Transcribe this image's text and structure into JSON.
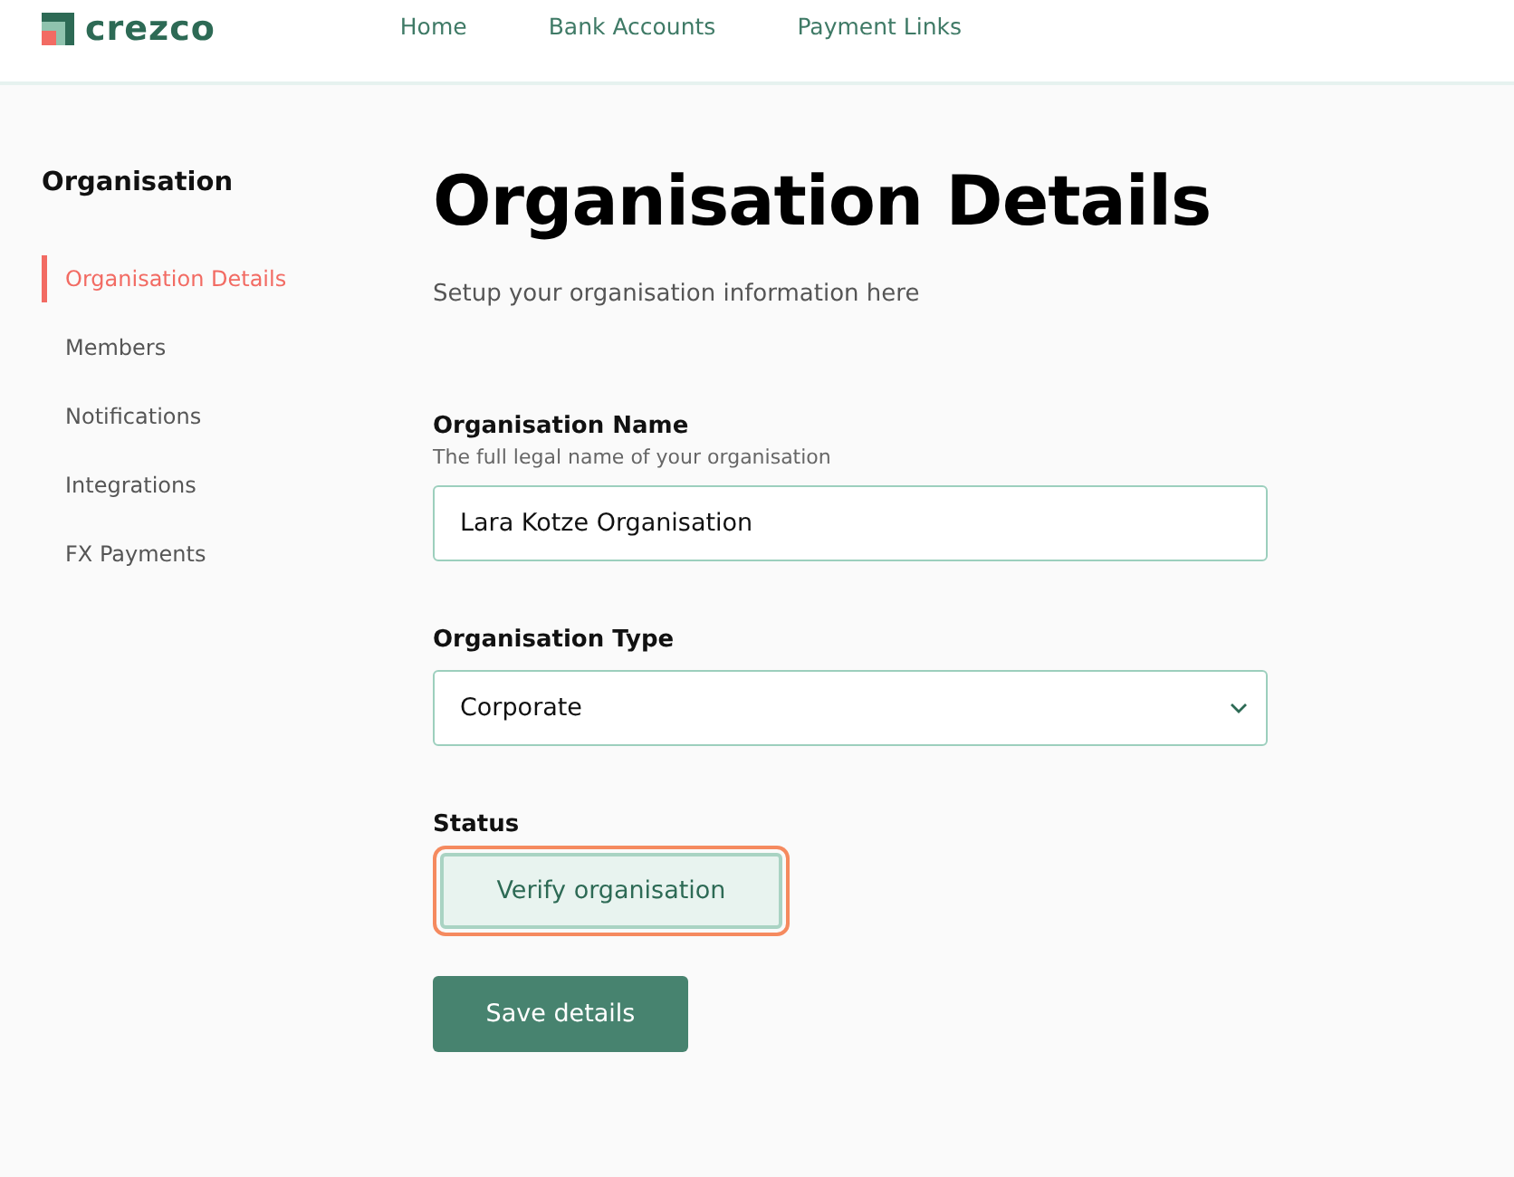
{
  "header": {
    "logo": "crezco",
    "nav": [
      {
        "label": "Home",
        "selected": false
      },
      {
        "label": "Bank Accounts",
        "selected": false
      },
      {
        "label": "Payment Links",
        "selected": false
      }
    ]
  },
  "sidebar": {
    "title": "Organisation",
    "items": [
      {
        "label": "Organisation Details",
        "selected": true
      },
      {
        "label": "Members",
        "selected": false
      },
      {
        "label": "Notifications",
        "selected": false
      },
      {
        "label": "Integrations",
        "selected": false
      },
      {
        "label": "FX Payments",
        "selected": false
      }
    ]
  },
  "page": {
    "title": "Organisation Details",
    "subtitle": "Setup your organisation information here"
  },
  "form": {
    "fields": [
      {
        "kind": "text",
        "label": "Organisation Name",
        "hint": "The full legal name of your organisation",
        "value": "Lara Kotze Organisation"
      },
      {
        "kind": "select",
        "label": "Organisation Type",
        "value": "Corporate"
      },
      {
        "kind": "button",
        "label": "Status",
        "button": "Verify organisation",
        "focused": true
      }
    ],
    "submit": "Save details"
  }
}
